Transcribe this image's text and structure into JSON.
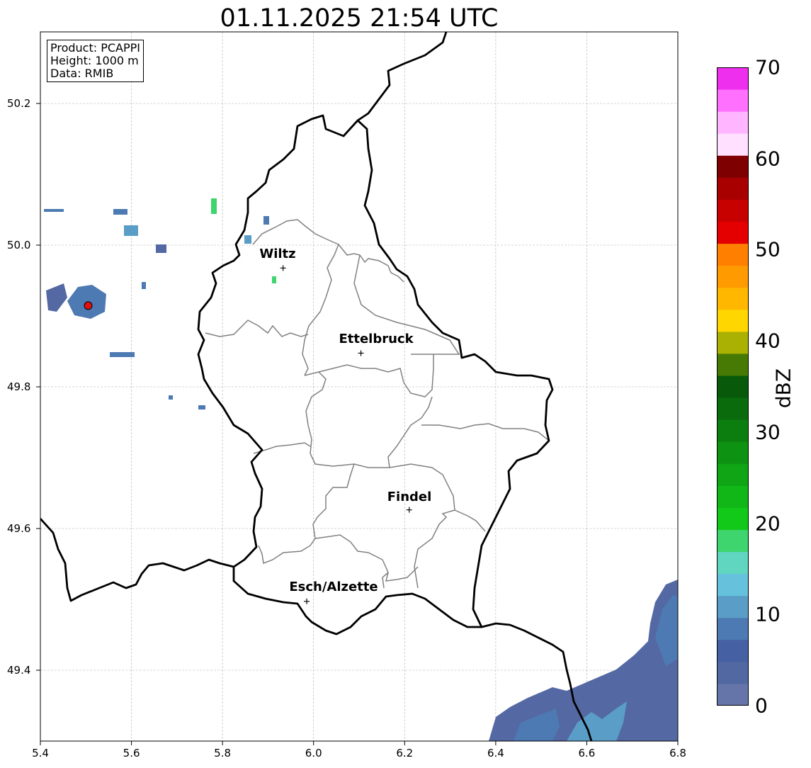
{
  "title": "01.11.2025 21:54 UTC",
  "info": {
    "product": "Product: PCAPPI",
    "height": "Height: 1000 m",
    "data": "Data: RMIB"
  },
  "map": {
    "lon_range": [
      5.4,
      6.8
    ],
    "lat_range": [
      49.3,
      50.3
    ],
    "grid": true,
    "x_ticks": [
      "5.4",
      "5.6",
      "5.8",
      "6.0",
      "6.2",
      "6.4",
      "6.6",
      "6.8"
    ],
    "y_ticks": [
      "49.4",
      "49.6",
      "49.8",
      "50.0",
      "50.2"
    ],
    "radar_site": {
      "lon": 5.505,
      "lat": 49.914,
      "color": "#e01010"
    },
    "cities": [
      {
        "name": "Wiltz",
        "lon": 5.933,
        "lat": 49.967
      },
      {
        "name": "Ettelbruck",
        "lon": 6.104,
        "lat": 49.847
      },
      {
        "name": "Findel",
        "lon": 6.21,
        "lat": 49.626
      },
      {
        "name": "Esch/Alzette",
        "lon": 5.985,
        "lat": 49.497
      }
    ]
  },
  "colorbar": {
    "label": "dBZ",
    "min": 0,
    "max": 70,
    "ticks": [
      "0",
      "10",
      "20",
      "30",
      "40",
      "50",
      "60",
      "70"
    ],
    "colors": [
      "#6675a9",
      "#5268a2",
      "#4561a3",
      "#4d7ab2",
      "#5a9ec7",
      "#66c1dd",
      "#60d5c0",
      "#3ed46e",
      "#12c819",
      "#10b717",
      "#0fa514",
      "#0e9211",
      "#0c7e10",
      "#0a6b0d",
      "#085a0a",
      "#477a05",
      "#aab103",
      "#ffd600",
      "#ffb700",
      "#ff9b00",
      "#ff7f00",
      "#e50000",
      "#c70000",
      "#a80000",
      "#7f0000",
      "#ffe0ff",
      "#ffb5ff",
      "#ff70ff",
      "#ee30ee"
    ]
  }
}
